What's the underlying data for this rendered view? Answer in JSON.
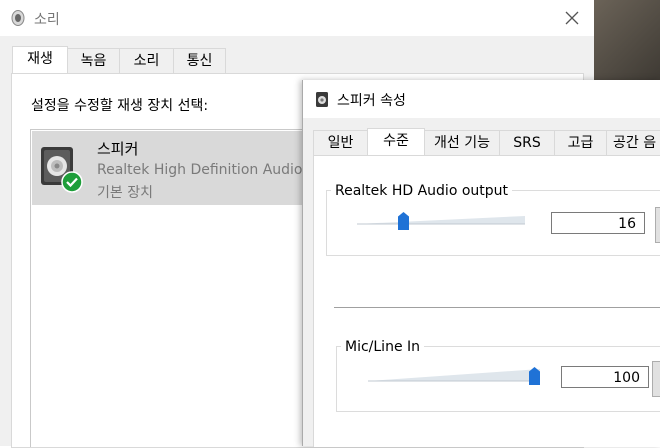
{
  "sound_window": {
    "title": "소리",
    "tabs": [
      "재생",
      "녹음",
      "소리",
      "통신"
    ],
    "prompt": "설정을 수정할 재생 장치 선택:",
    "device": {
      "name": "스피커",
      "description": "Realtek High Definition Audio",
      "status": "기본 장치",
      "icon": "speaker-icon",
      "badge_icon": "checkmark-icon"
    }
  },
  "props_window": {
    "title": "스피커 속성",
    "tabs": [
      "일반",
      "수준",
      "개선 기능",
      "SRS",
      "고급",
      "공간 음"
    ],
    "selected_tab": "수준",
    "controls": [
      {
        "label": "Realtek HD Audio output",
        "level": 16,
        "level_text": "16"
      },
      {
        "label": "Mic/Line In",
        "level": 100,
        "level_text": "100"
      }
    ]
  },
  "colors": {
    "accent": "#1f72d6",
    "check_green": "#1e9e3a",
    "selection": "#d9d9d9"
  }
}
